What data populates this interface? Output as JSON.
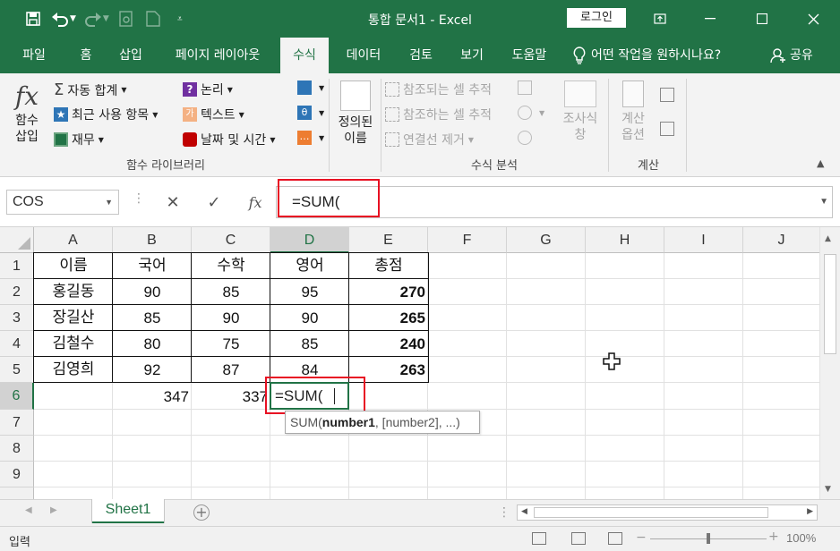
{
  "window": {
    "title": "통합 문서1  -  Excel",
    "login_label": "로그인"
  },
  "tabs": [
    {
      "label": "파일"
    },
    {
      "label": "홈"
    },
    {
      "label": "삽입"
    },
    {
      "label": "페이지 레이아웃"
    },
    {
      "label": "수식",
      "active": true
    },
    {
      "label": "데이터"
    },
    {
      "label": "검토"
    },
    {
      "label": "보기"
    },
    {
      "label": "도움말"
    }
  ],
  "tell_me": "어떤 작업을 원하시나요?",
  "share": "공유",
  "ribbon": {
    "insert_function": "함수\n삽입",
    "autosum": "자동 합계",
    "recent": "최근 사용 항목",
    "financial": "재무",
    "logical": "논리",
    "text": "텍스트",
    "datetime": "날짜 및 시간",
    "group_library": "함수 라이브러리",
    "defined_names": "정의된\n이름",
    "trace_precedents": "참조되는 셀 추적",
    "trace_dependents": "참조하는 셀 추적",
    "remove_arrows": "연결선 제거",
    "watch_window": "조사식\n창",
    "group_auditing": "수식 분석",
    "calc_options": "계산\n옵션",
    "group_calc": "계산"
  },
  "formula_bar": {
    "name_box": "COS",
    "formula": "=SUM("
  },
  "columns": [
    "A",
    "B",
    "C",
    "D",
    "E",
    "F",
    "G",
    "H",
    "I",
    "J"
  ],
  "rows": [
    "1",
    "2",
    "3",
    "4",
    "5",
    "6",
    "7",
    "8",
    "9"
  ],
  "table": {
    "headers": [
      "이름",
      "국어",
      "수학",
      "영어",
      "총점"
    ],
    "data": [
      [
        "홍길동",
        "90",
        "85",
        "95",
        "270"
      ],
      [
        "장길산",
        "85",
        "90",
        "90",
        "265"
      ],
      [
        "김철수",
        "80",
        "75",
        "85",
        "240"
      ],
      [
        "김영희",
        "92",
        "87",
        "84",
        "263"
      ]
    ],
    "row6": {
      "b": "347",
      "c": "337",
      "d": "=SUM("
    }
  },
  "tooltip": {
    "fn": "SUM(",
    "arg1": "number1",
    "rest": ", [number2], ...)"
  },
  "sheet_tab": "Sheet1",
  "status": {
    "mode": "입력",
    "zoom": "100%"
  },
  "colors": {
    "accent": "#217346",
    "highlight": "#e81123"
  }
}
